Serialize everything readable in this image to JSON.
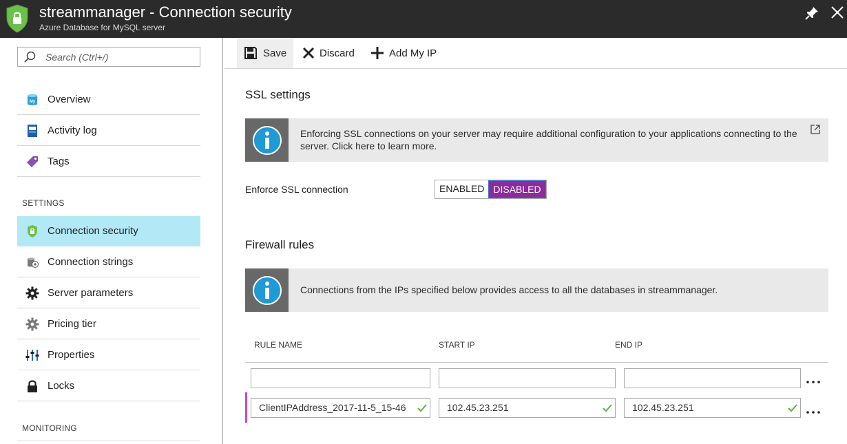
{
  "window": {
    "title": "streammanager - Connection security",
    "subtitle": "Azure Database for MySQL server",
    "app_icon": "shield-icon",
    "pin_icon": "pin-icon",
    "close_icon": "close-icon"
  },
  "search": {
    "placeholder": "Search (Ctrl+/)"
  },
  "nav": {
    "items": [
      {
        "label": "Overview",
        "icon": "mysql-database-icon"
      },
      {
        "label": "Activity log",
        "icon": "activity-log-icon"
      },
      {
        "label": "Tags",
        "icon": "tag-icon"
      }
    ],
    "settings_header": "SETTINGS",
    "settings_items": [
      {
        "label": "Connection security",
        "icon": "shield-icon",
        "active": true
      },
      {
        "label": "Connection strings",
        "icon": "connection-strings-icon"
      },
      {
        "label": "Server parameters",
        "icon": "gear-icon"
      },
      {
        "label": "Pricing tier",
        "icon": "pricing-gear-icon"
      },
      {
        "label": "Properties",
        "icon": "properties-sliders-icon"
      },
      {
        "label": "Locks",
        "icon": "lock-icon"
      }
    ],
    "monitoring_header": "MONITORING"
  },
  "toolbar": {
    "save_label": "Save",
    "discard_label": "Discard",
    "add_ip_label": "Add My IP"
  },
  "ssl": {
    "heading": "SSL settings",
    "info_text": "Enforcing SSL connections on your server may require additional configuration to your applications connecting to the server.  Click here to learn more.",
    "enforce_label": "Enforce SSL connection",
    "option_enabled": "ENABLED",
    "option_disabled": "DISABLED",
    "selected": "DISABLED"
  },
  "firewall": {
    "heading": "Firewall rules",
    "info_text": "Connections from the IPs specified below provides access to all the databases in streammanager.",
    "columns": [
      "RULE NAME",
      "START IP",
      "END IP"
    ],
    "rows": [
      {
        "rule_name": "",
        "start_ip": "",
        "end_ip": ""
      },
      {
        "rule_name": "ClientIPAddress_2017-11-5_15-46",
        "start_ip": "102.45.23.251",
        "end_ip": "102.45.23.251"
      }
    ]
  },
  "colors": {
    "titlebar_bg": "#2b2b2b",
    "active_nav_bg": "#b3e9f7",
    "toggle_on_bg": "#8c2b9c",
    "info_icon_bg": "#686868",
    "valid_check": "#5bb53b",
    "row_marker": "#cc48c0"
  }
}
